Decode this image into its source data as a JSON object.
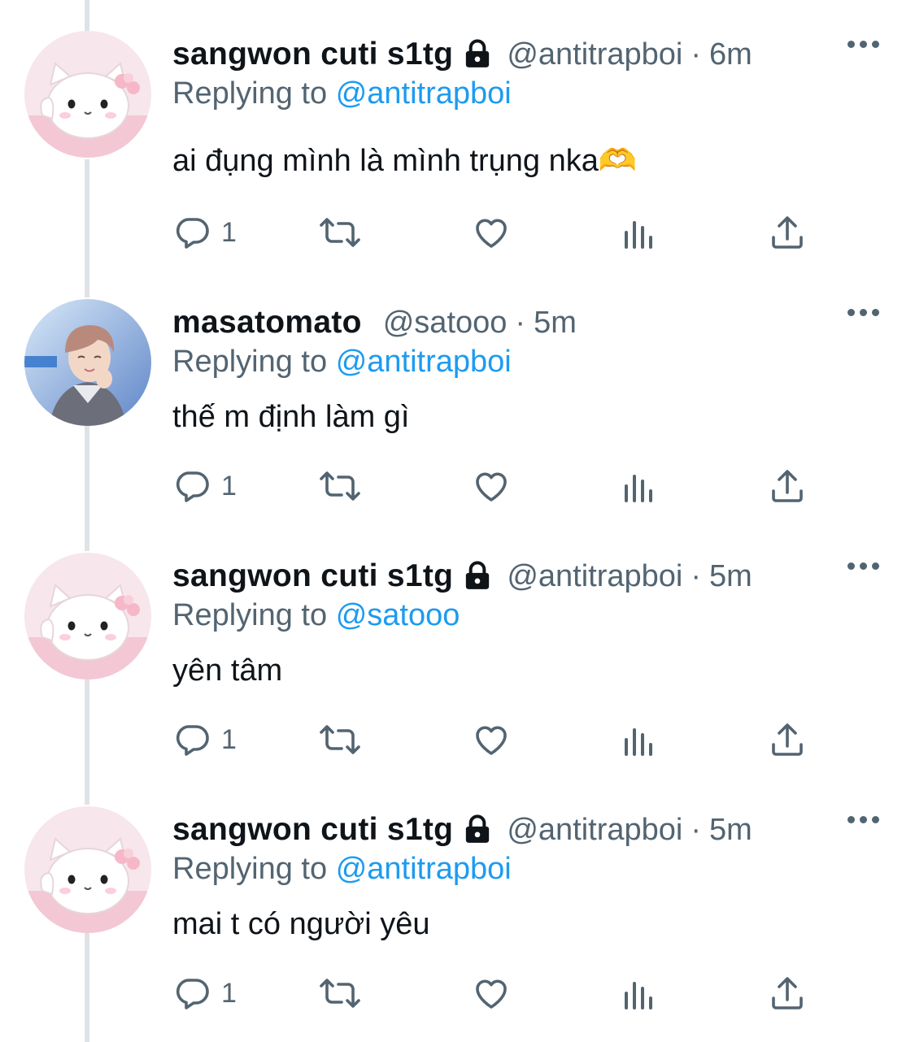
{
  "tweets": [
    {
      "name": "sangwon cuti s1tg",
      "handle": "@antitrapboi",
      "time": "6m",
      "replying_label": "Replying to",
      "replying_to": "@antitrapboi",
      "text": "ai đụng mình là mình trụng nka🫶",
      "reply_count": "1",
      "avatar": "hello-kitty-avatar",
      "protected": true
    },
    {
      "name": "masatomato",
      "handle": "@satooo",
      "time": "5m",
      "replying_label": "Replying to",
      "replying_to": "@antitrapboi",
      "text": "thế m định làm gì",
      "reply_count": "1",
      "avatar": "person-photo-avatar",
      "protected": false
    },
    {
      "name": "sangwon cuti s1tg",
      "handle": "@antitrapboi",
      "time": "5m",
      "replying_label": "Replying to",
      "replying_to": "@satooo",
      "text": "yên tâm",
      "reply_count": "1",
      "avatar": "hello-kitty-avatar",
      "protected": true
    },
    {
      "name": "sangwon cuti s1tg",
      "handle": "@antitrapboi",
      "time": "5m",
      "replying_label": "Replying to",
      "replying_to": "@antitrapboi",
      "text": "mai t có người yêu",
      "reply_count": "1",
      "avatar": "hello-kitty-avatar",
      "protected": true
    }
  ],
  "separator": "·",
  "icons": [
    "reply-icon",
    "retweet-icon",
    "like-icon",
    "views-icon",
    "share-icon",
    "lock-icon",
    "more-icon"
  ],
  "colors": {
    "text": "#0f1419",
    "muted": "#536471",
    "link": "#1d9bf0",
    "thread": "#dfe3e6"
  }
}
